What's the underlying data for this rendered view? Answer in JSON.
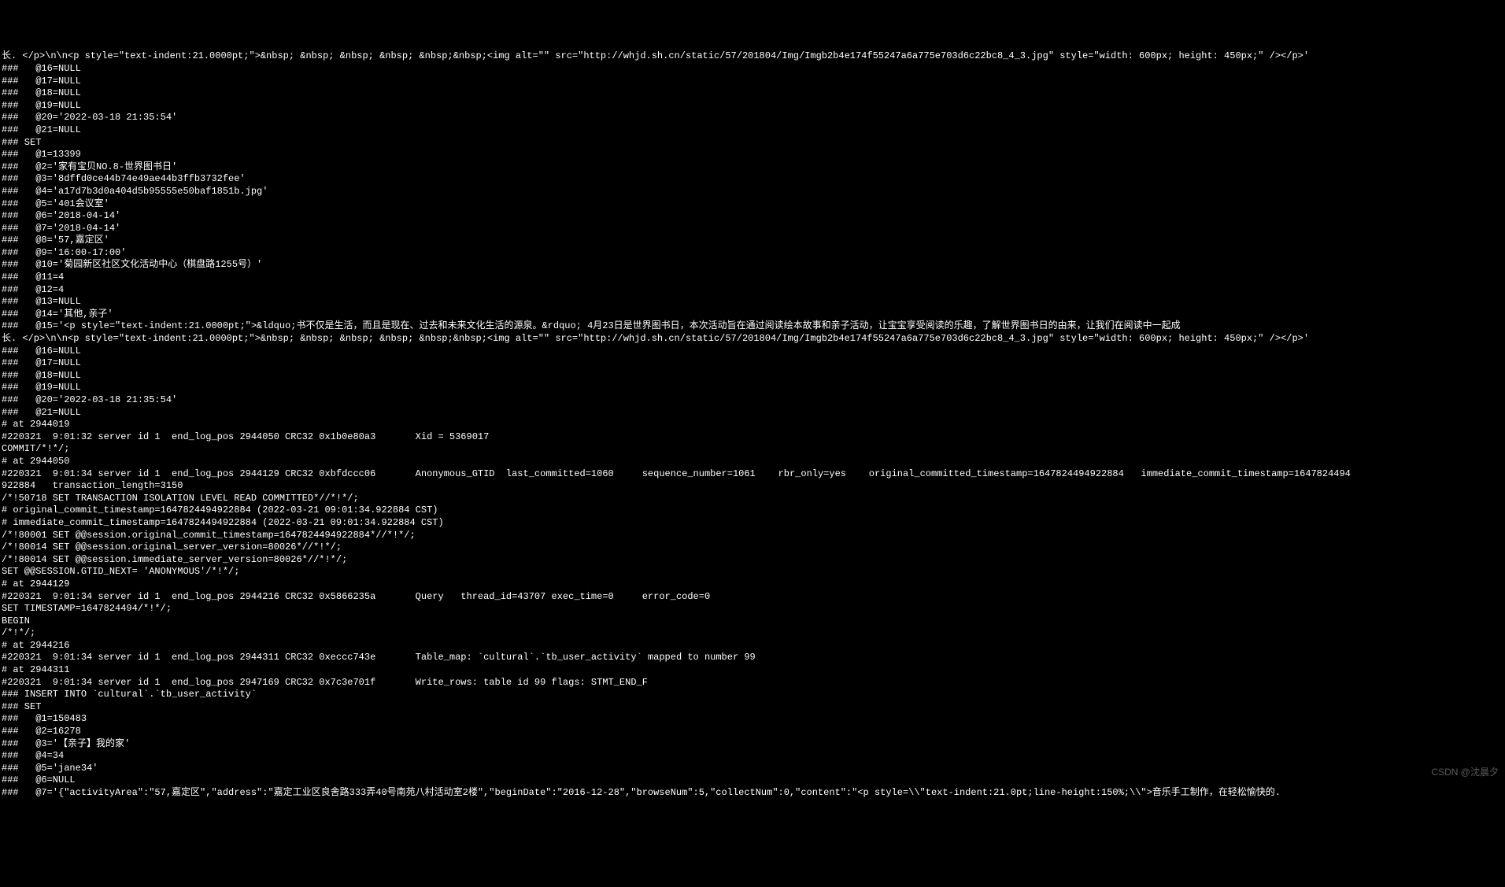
{
  "watermark": "CSDN @沈晨夕",
  "lines": [
    "长. </p>\\n\\n<p style=\"text-indent:21.0000pt;\">&nbsp; &nbsp; &nbsp; &nbsp; &nbsp;&nbsp;<img alt=\"\" src=\"http://whjd.sh.cn/static/57/201804/Img/Imgb2b4e174f55247a6a775e703d6c22bc8_4_3.jpg\" style=\"width: 600px; height: 450px;\" /></p>'",
    "###   @16=NULL",
    "###   @17=NULL",
    "###   @18=NULL",
    "###   @19=NULL",
    "###   @20='2022-03-18 21:35:54'",
    "###   @21=NULL",
    "### SET",
    "###   @1=13399",
    "###   @2='家有宝贝NO.8-世界图书日'",
    "###   @3='8dffd0ce44b74e49ae44b3ffb3732fee'",
    "###   @4='a17d7b3d0a404d5b95555e50baf1851b.jpg'",
    "###   @5='401会议室'",
    "###   @6='2018-04-14'",
    "###   @7='2018-04-14'",
    "###   @8='57,嘉定区'",
    "###   @9='16:00-17:00'",
    "###   @10='菊园新区社区文化活动中心（棋盘路1255号）'",
    "###   @11=4",
    "###   @12=4",
    "###   @13=NULL",
    "###   @14='其他,亲子'",
    "###   @15='<p style=\"text-indent:21.0000pt;\">&ldquo;书不仅是生活，而且是现在、过去和未来文化生活的源泉。&rdquo; 4月23日是世界图书日，本次活动旨在通过阅读绘本故事和亲子活动，让宝宝享受阅读的乐趣，了解世界图书日的由来，让我们在阅读中一起成",
    "长. </p>\\n\\n<p style=\"text-indent:21.0000pt;\">&nbsp; &nbsp; &nbsp; &nbsp; &nbsp;&nbsp;<img alt=\"\" src=\"http://whjd.sh.cn/static/57/201804/Img/Imgb2b4e174f55247a6a775e703d6c22bc8_4_3.jpg\" style=\"width: 600px; height: 450px;\" /></p>'",
    "###   @16=NULL",
    "###   @17=NULL",
    "###   @18=NULL",
    "###   @19=NULL",
    "###   @20='2022-03-18 21:35:54'",
    "###   @21=NULL",
    "# at 2944019",
    "#220321  9:01:32 server id 1  end_log_pos 2944050 CRC32 0x1b0e80a3       Xid = 5369017",
    "COMMIT/*!*/;",
    "# at 2944050",
    "#220321  9:01:34 server id 1  end_log_pos 2944129 CRC32 0xbfdccc06       Anonymous_GTID  last_committed=1060     sequence_number=1061    rbr_only=yes    original_committed_timestamp=1647824494922884   immediate_commit_timestamp=1647824494",
    "922884   transaction_length=3150",
    "/*!50718 SET TRANSACTION ISOLATION LEVEL READ COMMITTED*//*!*/;",
    "# original_commit_timestamp=1647824494922884 (2022-03-21 09:01:34.922884 CST)",
    "# immediate_commit_timestamp=1647824494922884 (2022-03-21 09:01:34.922884 CST)",
    "/*!80001 SET @@session.original_commit_timestamp=1647824494922884*//*!*/;",
    "/*!80014 SET @@session.original_server_version=80026*//*!*/;",
    "/*!80014 SET @@session.immediate_server_version=80026*//*!*/;",
    "SET @@SESSION.GTID_NEXT= 'ANONYMOUS'/*!*/;",
    "# at 2944129",
    "#220321  9:01:34 server id 1  end_log_pos 2944216 CRC32 0x5866235a       Query   thread_id=43707 exec_time=0     error_code=0",
    "SET TIMESTAMP=1647824494/*!*/;",
    "BEGIN",
    "/*!*/;",
    "# at 2944216",
    "#220321  9:01:34 server id 1  end_log_pos 2944311 CRC32 0xeccc743e       Table_map: `cultural`.`tb_user_activity` mapped to number 99",
    "# at 2944311",
    "#220321  9:01:34 server id 1  end_log_pos 2947169 CRC32 0x7c3e701f       Write_rows: table id 99 flags: STMT_END_F",
    "### INSERT INTO `cultural`.`tb_user_activity`",
    "### SET",
    "###   @1=150483",
    "###   @2=16278",
    "###   @3='【亲子】我的家'",
    "###   @4=34",
    "###   @5='jane34'",
    "###   @6=NULL",
    "###   @7='{\"activityArea\":\"57,嘉定区\",\"address\":\"嘉定工业区良舍路333弄40号南苑八村活动室2楼\",\"beginDate\":\"2016-12-28\",\"browseNum\":5,\"collectNum\":0,\"content\":\"<p style=\\\\\"text-indent:21.0pt;line-height:150%;\\\\\">音乐手工制作，在轻松愉快的."
  ]
}
